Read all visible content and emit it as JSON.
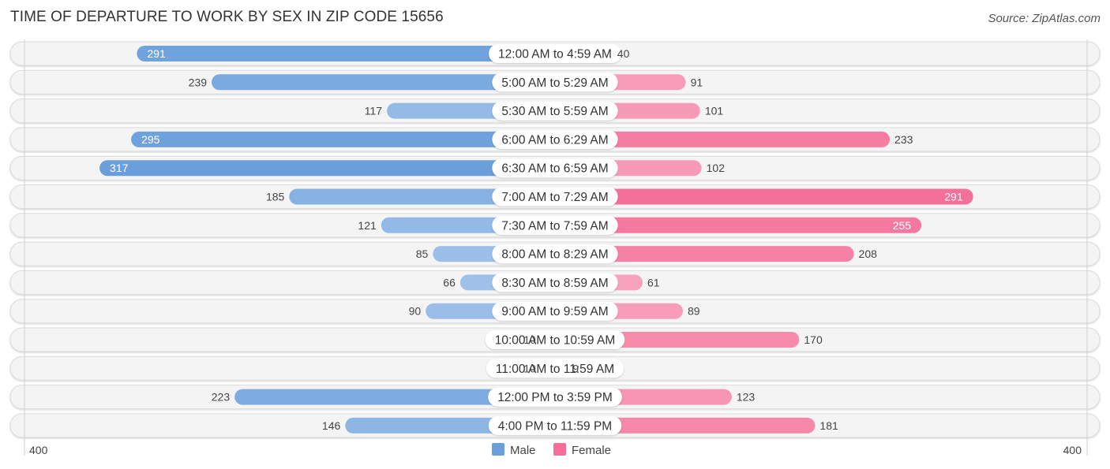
{
  "title": "TIME OF DEPARTURE TO WORK BY SEX IN ZIP CODE 15656",
  "source": "Source: ZipAtlas.com",
  "chart_data": {
    "type": "bar",
    "orientation": "horizontal-diverging",
    "title": "TIME OF DEPARTURE TO WORK BY SEX IN ZIP CODE 15656",
    "categories": [
      "12:00 AM to 4:59 AM",
      "5:00 AM to 5:29 AM",
      "5:30 AM to 5:59 AM",
      "6:00 AM to 6:29 AM",
      "6:30 AM to 6:59 AM",
      "7:00 AM to 7:29 AM",
      "7:30 AM to 7:59 AM",
      "8:00 AM to 8:29 AM",
      "8:30 AM to 8:59 AM",
      "9:00 AM to 9:59 AM",
      "10:00 AM to 10:59 AM",
      "11:00 AM to 11:59 AM",
      "12:00 PM to 3:59 PM",
      "4:00 PM to 11:59 PM"
    ],
    "series": [
      {
        "name": "Male",
        "color": "#6a9fdc",
        "values": [
          291,
          239,
          117,
          295,
          317,
          185,
          121,
          85,
          66,
          90,
          10,
          10,
          223,
          146
        ]
      },
      {
        "name": "Female",
        "color": "#f47099",
        "values": [
          40,
          91,
          101,
          233,
          102,
          291,
          255,
          208,
          61,
          89,
          170,
          9,
          123,
          181
        ]
      }
    ],
    "xlim": [
      -400,
      400
    ],
    "axis_labels": {
      "left": "400",
      "right": "400"
    },
    "legend": {
      "position": "bottom-center",
      "entries": [
        "Male",
        "Female"
      ]
    },
    "grid": false
  }
}
